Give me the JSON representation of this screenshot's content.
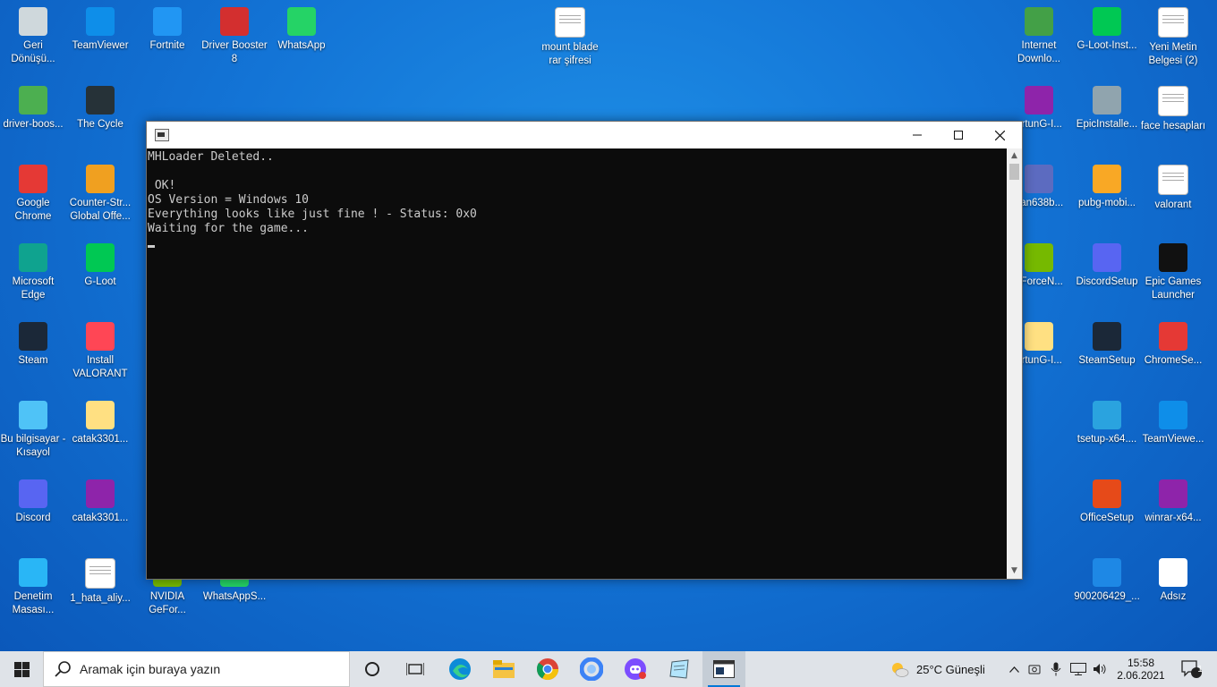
{
  "desktop": {
    "icons_left": [
      {
        "label": "Geri Dönüşü...",
        "icon": "recycle-bin-icon",
        "color": "#cfd8dc"
      },
      {
        "label": "TeamViewer",
        "icon": "teamviewer-icon",
        "color": "#0e8ee9"
      },
      {
        "label": "Fortnite",
        "icon": "fortnite-icon",
        "color": "#2196f3"
      },
      {
        "label": "Driver Booster 8",
        "icon": "driver-booster-icon",
        "color": "#d32f2f"
      },
      {
        "label": "WhatsApp",
        "icon": "whatsapp-icon",
        "color": "#25d366"
      },
      {
        "label": "driver-boos...",
        "icon": "iobit-icon",
        "color": "#4caf50"
      },
      {
        "label": "The Cycle",
        "icon": "the-cycle-icon",
        "color": "#263238"
      },
      {
        "label": "Google Chrome",
        "icon": "chrome-icon",
        "color": "#e53935"
      },
      {
        "label": "Counter-Str... Global Offe...",
        "icon": "csgo-icon",
        "color": "#f0a020"
      },
      {
        "label": "Microsoft Edge",
        "icon": "edge-icon",
        "color": "#0fa38f"
      },
      {
        "label": "G-Loot",
        "icon": "gloot-icon",
        "color": "#00c853"
      },
      {
        "label": "Steam",
        "icon": "steam-icon",
        "color": "#1b2838"
      },
      {
        "label": "Install VALORANT",
        "icon": "valorant-icon",
        "color": "#ff4655"
      },
      {
        "label": "Bu bilgisayar - Kısayol",
        "icon": "this-pc-icon",
        "color": "#4fc3f7"
      },
      {
        "label": "catak3301...",
        "icon": "folder-icon",
        "color": "#ffe082"
      },
      {
        "label": "Discord",
        "icon": "discord-icon",
        "color": "#5865f2"
      },
      {
        "label": "catak3301...",
        "icon": "winrar-icon",
        "color": "#8e24aa"
      },
      {
        "label": "Denetim Masası...",
        "icon": "control-panel-icon",
        "color": "#29b6f6"
      },
      {
        "label": "1_hata_aliy...",
        "icon": "text-file-icon",
        "color": "#ffffff"
      },
      {
        "label": "NVIDIA GeFor...",
        "icon": "nvidia-icon",
        "color": "#76b900"
      },
      {
        "label": "WhatsAppS...",
        "icon": "whatsapp-setup-icon",
        "color": "#25d366"
      }
    ],
    "icon_mount": {
      "label": "mount blade rar şifresi",
      "icon": "text-file-icon"
    },
    "icons_right": [
      {
        "label": "Internet Downlo...",
        "icon": "idm-icon",
        "color": "#43a047"
      },
      {
        "label": "G-Loot-Inst...",
        "icon": "gloot-installer-icon",
        "color": "#00c853"
      },
      {
        "label": "Yeni Metin Belgesi (2)",
        "icon": "text-file-icon",
        "color": "#ffffff"
      },
      {
        "label": "artunG-I...",
        "icon": "winrar-icon",
        "color": "#8e24aa"
      },
      {
        "label": "EpicInstalle...",
        "icon": "epic-installer-icon",
        "color": "#90a4ae"
      },
      {
        "label": "face hesapları",
        "icon": "text-file-icon",
        "color": "#ffffff"
      },
      {
        "label": "nan638b...",
        "icon": "game-shortcut-icon",
        "color": "#5c6bc0"
      },
      {
        "label": "pubg-mobi...",
        "icon": "pubg-icon",
        "color": "#f9a825"
      },
      {
        "label": "valorant",
        "icon": "text-file-icon",
        "color": "#ffffff"
      },
      {
        "label": "eForceN...",
        "icon": "nvidia-icon",
        "color": "#76b900"
      },
      {
        "label": "DiscordSetup",
        "icon": "discord-icon",
        "color": "#5865f2"
      },
      {
        "label": "Epic Games Launcher",
        "icon": "epic-games-icon",
        "color": "#111111"
      },
      {
        "label": "artunG-I...",
        "icon": "folder-icon",
        "color": "#ffe082"
      },
      {
        "label": "SteamSetup",
        "icon": "steam-icon",
        "color": "#1b2838"
      },
      {
        "label": "ChromeSe...",
        "icon": "chrome-setup-icon",
        "color": "#e53935"
      },
      {
        "label": "tsetup-x64....",
        "icon": "telegram-icon",
        "color": "#2aa3df"
      },
      {
        "label": "TeamViewe...",
        "icon": "teamviewer-icon",
        "color": "#0e8ee9"
      },
      {
        "label": "OfficeSetup",
        "icon": "office-icon",
        "color": "#e64a19"
      },
      {
        "label": "winrar-x64...",
        "icon": "winrar-icon",
        "color": "#8e24aa"
      },
      {
        "label": "900206429_...",
        "icon": "setup-icon",
        "color": "#1e88e5"
      },
      {
        "label": "Adsız",
        "icon": "card-icon",
        "color": "#ffffff"
      }
    ]
  },
  "console": {
    "lines": [
      "MHLoader Deleted..",
      "",
      " OK!",
      "OS Version = Windows 10",
      "Everything looks like just fine ! - Status: 0x0",
      "Waiting for the game..."
    ]
  },
  "taskbar": {
    "search_placeholder": "Aramak için buraya yazın",
    "weather": "25°C  Güneşli",
    "time": "15:58",
    "date": "2.06.2021",
    "notification_count": "1",
    "accent": "#0078d7"
  }
}
